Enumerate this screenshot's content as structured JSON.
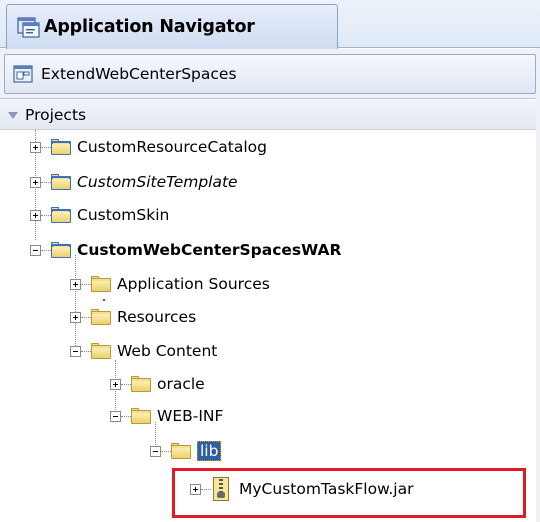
{
  "window": {
    "title": "Application Navigator",
    "app_name": "ExtendWebCenterSpaces"
  },
  "projects_header": "Projects",
  "tree": {
    "custom_resource_catalog": "CustomResourceCatalog",
    "custom_site_template": "CustomSiteTemplate",
    "custom_skin": "CustomSkin",
    "custom_webcenter_spaces_war": "CustomWebCenterSpacesWAR",
    "application_sources": "Application Sources",
    "resources": "Resources",
    "web_content": "Web Content",
    "oracle": "oracle",
    "web_inf": "WEB-INF",
    "lib": "lib",
    "jar_file": "MyCustomTaskFlow.jar"
  },
  "colors": {
    "selection": "#2f5ea6",
    "highlight_box": "#e01b24",
    "folder": "#f6df8a",
    "project_folder_border": "#3b6fbf"
  }
}
